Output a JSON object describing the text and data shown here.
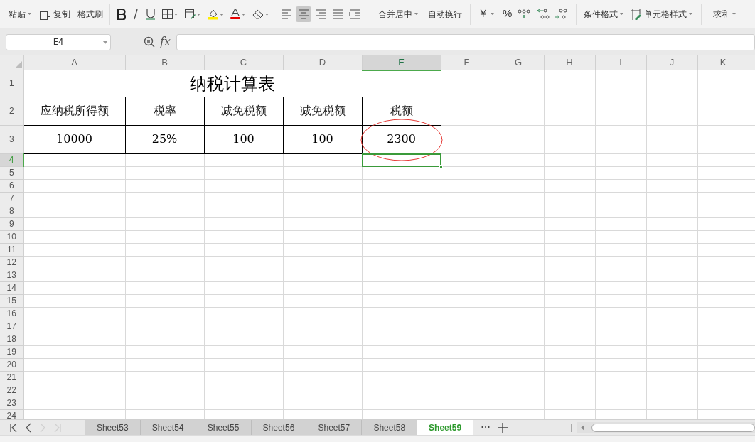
{
  "toolbar": {
    "paste": {
      "label": "粘贴"
    },
    "copy": {
      "label": "复制"
    },
    "format_painter": {
      "label": "格式刷"
    },
    "alignment": [
      {
        "selected": false
      },
      {
        "selected": true
      },
      {
        "selected": false
      },
      {
        "selected": false
      },
      {
        "selected": false
      }
    ],
    "merge_center": {
      "label": "合并居中"
    },
    "wrap_text": {
      "label": "自动换行"
    },
    "currency": {
      "label": "￥"
    },
    "percent": {
      "label": "%"
    },
    "conditional_format": {
      "label": "条件格式"
    },
    "cell_style": {
      "label": "单元格样式"
    },
    "sum": {
      "label": "求和"
    }
  },
  "formula_bar": {
    "name_box": "E4",
    "fx": "fx"
  },
  "sheet": {
    "columns": [
      {
        "label": "A",
        "selected": false
      },
      {
        "label": "B",
        "selected": false
      },
      {
        "label": "C",
        "selected": false
      },
      {
        "label": "D",
        "selected": false
      },
      {
        "label": "E",
        "selected": true
      },
      {
        "label": "F",
        "selected": false
      },
      {
        "label": "G",
        "selected": false
      },
      {
        "label": "H",
        "selected": false
      },
      {
        "label": "I",
        "selected": false
      },
      {
        "label": "J",
        "selected": false
      },
      {
        "label": "K",
        "selected": false
      }
    ],
    "rows": [
      {
        "label": "1",
        "selected": false
      },
      {
        "label": "2",
        "selected": false
      },
      {
        "label": "3",
        "selected": false
      },
      {
        "label": "4",
        "selected": true
      },
      {
        "label": "5",
        "selected": false
      },
      {
        "label": "6",
        "selected": false
      },
      {
        "label": "7",
        "selected": false
      },
      {
        "label": "8",
        "selected": false
      },
      {
        "label": "9",
        "selected": false
      },
      {
        "label": "10",
        "selected": false
      },
      {
        "label": "11",
        "selected": false
      },
      {
        "label": "12",
        "selected": false
      },
      {
        "label": "13",
        "selected": false
      },
      {
        "label": "14",
        "selected": false
      },
      {
        "label": "15",
        "selected": false
      },
      {
        "label": "16",
        "selected": false
      },
      {
        "label": "17",
        "selected": false
      },
      {
        "label": "18",
        "selected": false
      },
      {
        "label": "19",
        "selected": false
      },
      {
        "label": "20",
        "selected": false
      },
      {
        "label": "21",
        "selected": false
      },
      {
        "label": "22",
        "selected": false
      },
      {
        "label": "23",
        "selected": false
      },
      {
        "label": "24",
        "selected": false
      }
    ],
    "title": "纳税计算表",
    "header_row": [
      "应纳税所得额",
      "税率",
      "减免税额",
      "减免税额",
      "税额"
    ],
    "value_row": [
      {
        "text": "10000",
        "circled": false
      },
      {
        "text": "25%",
        "circled": false
      },
      {
        "text": "100",
        "circled": false
      },
      {
        "text": "100",
        "circled": false
      },
      {
        "text": "2300",
        "circled": true
      }
    ]
  },
  "sheet_tabs": [
    {
      "label": "Sheet53",
      "selected": false
    },
    {
      "label": "Sheet54",
      "selected": false
    },
    {
      "label": "Sheet55",
      "selected": false
    },
    {
      "label": "Sheet56",
      "selected": false
    },
    {
      "label": "Sheet57",
      "selected": false
    },
    {
      "label": "Sheet58",
      "selected": false
    },
    {
      "label": "Sheet59",
      "selected": true
    }
  ],
  "tab_more": "⋯"
}
